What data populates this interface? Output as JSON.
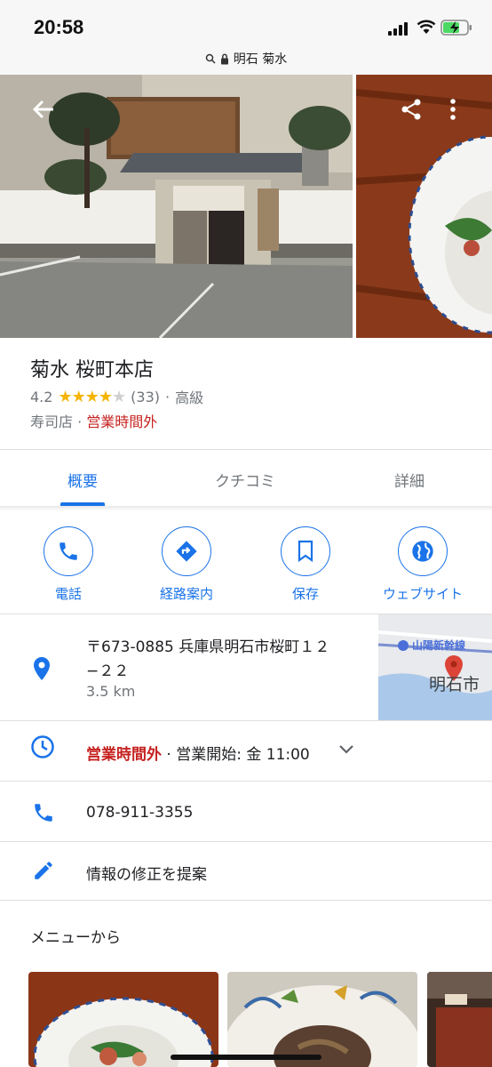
{
  "status_bar": {
    "time": "20:58"
  },
  "url_bar": {
    "text": "明石 菊水"
  },
  "colors": {
    "accent": "#1a73e8",
    "closed": "#c5221f",
    "star": "#f4b400",
    "secondary_text": "#70757a"
  },
  "place": {
    "name": "菊水 桜町本店",
    "rating": "4.2",
    "stars_filled": 4,
    "stars_total": 5,
    "review_count": "(33)",
    "price_level": "高級",
    "category": "寿司店",
    "status": "営業時間外"
  },
  "tabs": [
    {
      "label": "概要",
      "active": true
    },
    {
      "label": "クチコミ",
      "active": false
    },
    {
      "label": "詳細",
      "active": false
    }
  ],
  "actions": [
    {
      "label": "電話",
      "icon": "phone-icon"
    },
    {
      "label": "経路案内",
      "icon": "directions-icon"
    },
    {
      "label": "保存",
      "icon": "bookmark-icon"
    },
    {
      "label": "ウェブサイト",
      "icon": "globe-icon"
    }
  ],
  "address": {
    "line1": "〒673-0885 兵庫県明石市桜町１２",
    "line2": "−２２",
    "distance": "3.5 km",
    "map_label": "明石市",
    "map_line_label": "山陽新幹線"
  },
  "hours": {
    "status": "営業時間外",
    "separator": " · ",
    "next_open": "営業開始: 金 11:00"
  },
  "phone": "078-911-3355",
  "suggest_edit": "情報の修正を提案",
  "menu_section": {
    "title": "メニューから"
  }
}
